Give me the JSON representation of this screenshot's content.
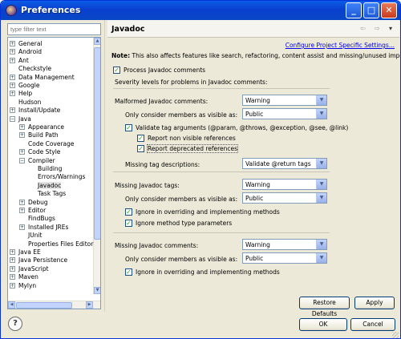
{
  "window": {
    "title": "Preferences",
    "min_symbol": "_",
    "max_symbol": "□",
    "close_symbol": "✕"
  },
  "filter": {
    "placeholder": "type filter text"
  },
  "tree": [
    {
      "label": "General",
      "toggle": "+"
    },
    {
      "label": "Android",
      "toggle": "+"
    },
    {
      "label": "Ant",
      "toggle": "+"
    },
    {
      "label": "Checkstyle",
      "toggle": ""
    },
    {
      "label": "Data Management",
      "toggle": "+"
    },
    {
      "label": "Google",
      "toggle": "+"
    },
    {
      "label": "Help",
      "toggle": "+"
    },
    {
      "label": "Hudson",
      "toggle": ""
    },
    {
      "label": "Install/Update",
      "toggle": "+"
    },
    {
      "label": "Java",
      "toggle": "−"
    },
    {
      "label": "Appearance",
      "toggle": "+"
    },
    {
      "label": "Build Path",
      "toggle": "+"
    },
    {
      "label": "Code Coverage",
      "toggle": ""
    },
    {
      "label": "Code Style",
      "toggle": "+"
    },
    {
      "label": "Compiler",
      "toggle": "−"
    },
    {
      "label": "Building",
      "toggle": ""
    },
    {
      "label": "Errors/Warnings",
      "toggle": ""
    },
    {
      "label": "Javadoc",
      "toggle": ""
    },
    {
      "label": "Task Tags",
      "toggle": ""
    },
    {
      "label": "Debug",
      "toggle": "+"
    },
    {
      "label": "Editor",
      "toggle": "+"
    },
    {
      "label": "FindBugs",
      "toggle": ""
    },
    {
      "label": "Installed JREs",
      "toggle": "+"
    },
    {
      "label": "JUnit",
      "toggle": ""
    },
    {
      "label": "Properties Files Editor",
      "toggle": ""
    },
    {
      "label": "Java EE",
      "toggle": "+"
    },
    {
      "label": "Java Persistence",
      "toggle": "+"
    },
    {
      "label": "JavaScript",
      "toggle": "+"
    },
    {
      "label": "Maven",
      "toggle": "+"
    },
    {
      "label": "Mylyn",
      "toggle": "+"
    }
  ],
  "page": {
    "title": "Javadoc",
    "nav_back": "⇦",
    "nav_forward": "⇨",
    "nav_menu": "▾",
    "configure_link": "Configure Project Specific Settings...",
    "note_label": "Note:",
    "note_text": " This also affects features like search, refactoring, content assist and missing/unused imports.",
    "process_label": "Process Javadoc comments",
    "severity_label": "Severity levels for problems in Javadoc comments:",
    "malformed_label": "Malformed Javadoc comments:",
    "malformed_value": "Warning",
    "malformed_visibility_label": "Only consider members as visible as:",
    "malformed_visibility_value": "Public",
    "validate_args_label": "Validate tag arguments (@param, @throws, @exception, @see, @link)",
    "non_visible_label": "Report non visible references",
    "deprecated_label": "Report deprecated references",
    "missing_desc_label": "Missing tag descriptions:",
    "missing_desc_value": "Validate @return tags",
    "missing_tags_label": "Missing Javadoc tags:",
    "missing_tags_value": "Warning",
    "missing_tags_visibility_label": "Only consider members as visible as:",
    "missing_tags_visibility_value": "Public",
    "ignore_overriding_tags_label": "Ignore in overriding and implementing methods",
    "ignore_method_type_label": "Ignore method type parameters",
    "missing_comments_label": "Missing Javadoc comments:",
    "missing_comments_value": "Warning",
    "missing_comments_visibility_label": "Only consider members as visible as:",
    "missing_comments_visibility_value": "Public",
    "ignore_overriding_comments_label": "Ignore in overriding and implementing methods",
    "restore_defaults": "Restore Defaults",
    "apply": "Apply",
    "checkmark": "✓",
    "dropdown_arrow": "▼"
  },
  "footer": {
    "help": "?",
    "ok": "OK",
    "cancel": "Cancel"
  },
  "colors": {
    "titlebar": "#0a3fcf",
    "link": "#0000ee",
    "check": "#21a121"
  }
}
